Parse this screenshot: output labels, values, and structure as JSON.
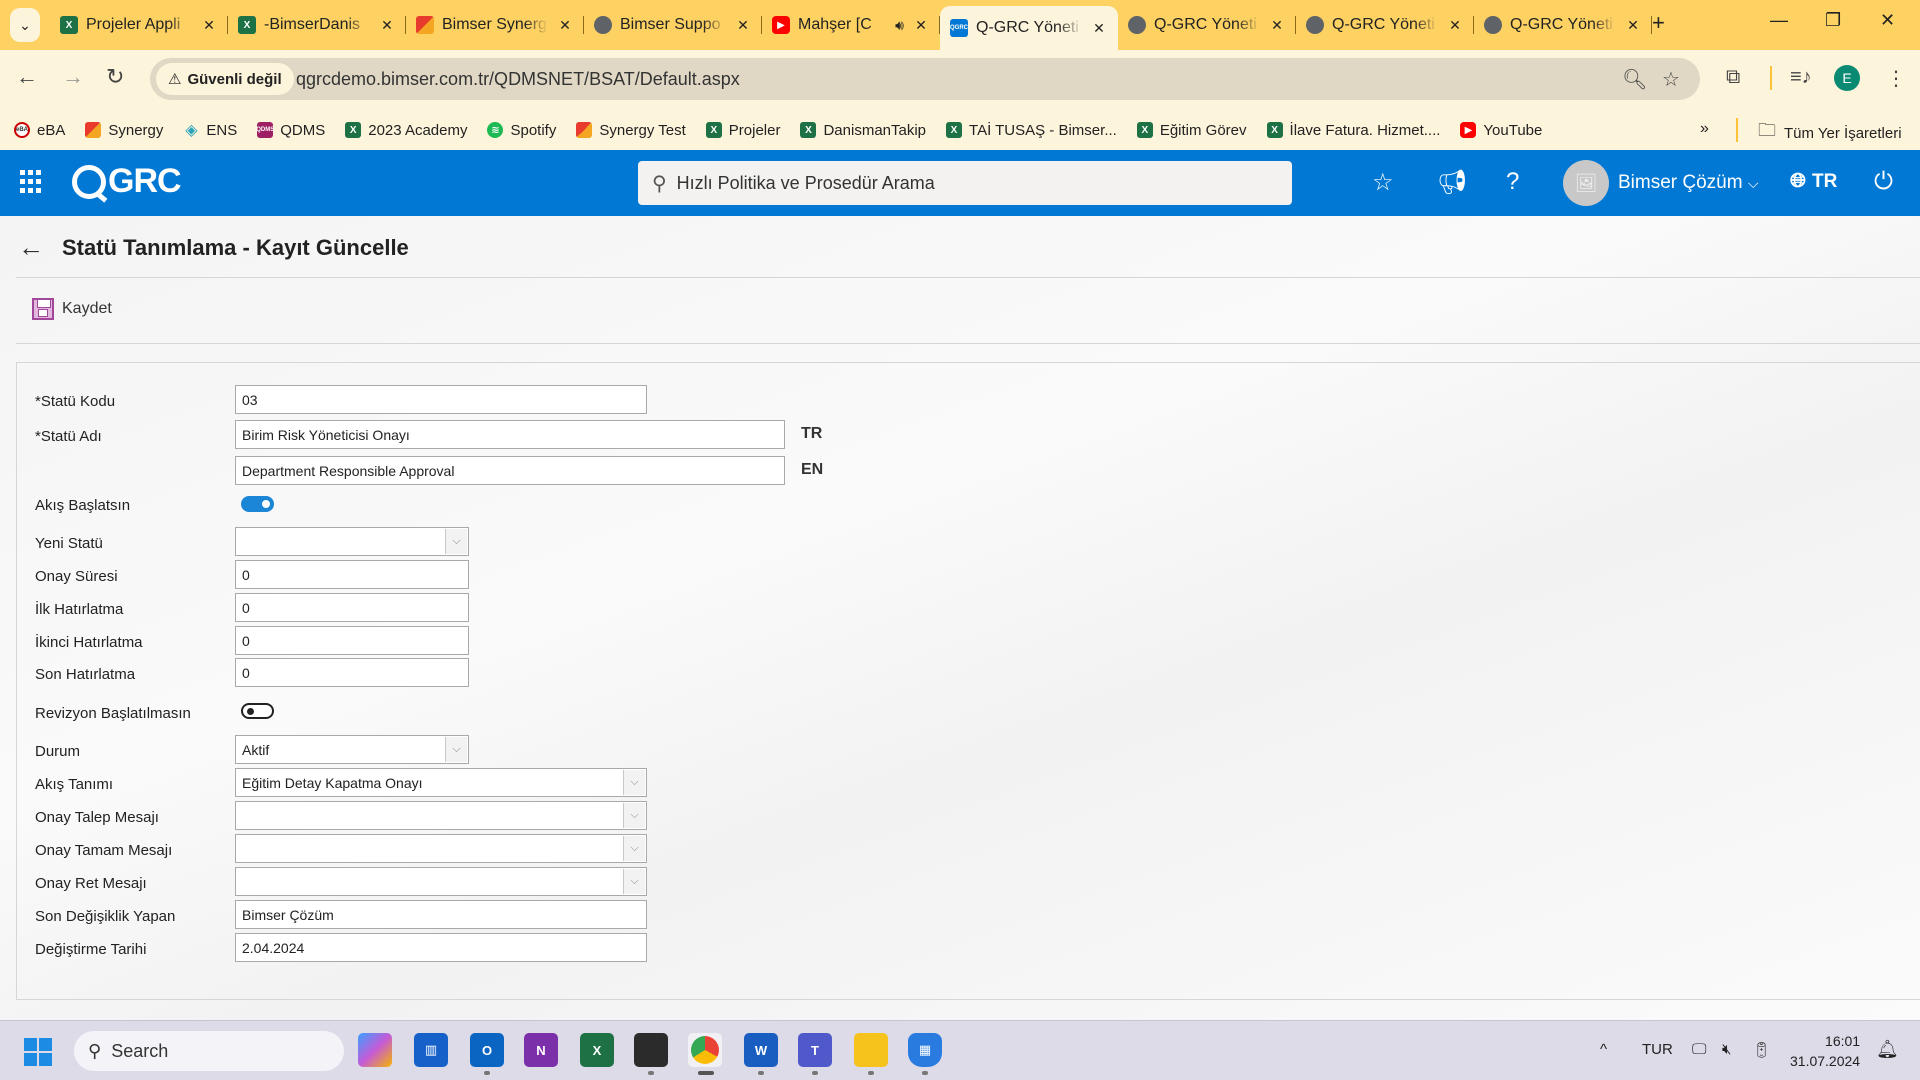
{
  "browser": {
    "tabs": [
      {
        "title": "Projeler Appli",
        "icon": "excel-icon",
        "active": false
      },
      {
        "title": "-BimserDanis",
        "icon": "excel-icon",
        "active": false
      },
      {
        "title": "Bimser Synerg",
        "icon": "synergy-icon",
        "active": false
      },
      {
        "title": "Bimser Suppo",
        "icon": "globe-icon",
        "active": false
      },
      {
        "title": "Mahşer [C",
        "icon": "youtube-icon",
        "active": false,
        "audio": true
      },
      {
        "title": "Q-GRC Yöneti",
        "icon": "qgrc-icon",
        "active": true
      },
      {
        "title": "Q-GRC Yöneti",
        "icon": "globe-icon",
        "active": false
      },
      {
        "title": "Q-GRC Yöneti",
        "icon": "globe-icon",
        "active": false
      },
      {
        "title": "Q-GRC Yöneti",
        "icon": "globe-icon",
        "active": false
      }
    ],
    "security_label": "Güvenli değil",
    "url": "qgrcdemo.bimser.com.tr/QDMSNET/BSAT/Default.aspx",
    "profile_initial": "E",
    "bookmarks": [
      {
        "label": "eBA",
        "icon": "eba-icon"
      },
      {
        "label": "Synergy",
        "icon": "synergy-icon"
      },
      {
        "label": "ENS",
        "icon": "ens-icon"
      },
      {
        "label": "QDMS",
        "icon": "qdms-icon"
      },
      {
        "label": "2023 Academy",
        "icon": "excel-icon"
      },
      {
        "label": "Spotify",
        "icon": "spotify-icon"
      },
      {
        "label": "Synergy Test",
        "icon": "synergy-icon"
      },
      {
        "label": "Projeler",
        "icon": "excel-icon"
      },
      {
        "label": "DanismanTakip",
        "icon": "excel-icon"
      },
      {
        "label": "TAİ TUSAŞ - Bimser...",
        "icon": "excel-icon"
      },
      {
        "label": "Eğitim Görev",
        "icon": "excel-icon"
      },
      {
        "label": "İlave Fatura. Hizmet....",
        "icon": "excel-icon"
      },
      {
        "label": "YouTube",
        "icon": "youtube-icon"
      }
    ],
    "all_bookmarks_label": "Tüm Yer İşaretleri"
  },
  "app": {
    "logo": "GRC",
    "search_placeholder": "Hızlı Politika ve Prosedür Arama",
    "user_name": "Bimser Çözüm",
    "language": "TR",
    "brand_color": "#0078d4"
  },
  "page": {
    "title": "Statü Tanımlama - Kayıt Güncelle",
    "save_label": "Kaydet"
  },
  "form": {
    "status_code": {
      "label": "*Statü Kodu",
      "value": "03"
    },
    "status_name": {
      "label": "*Statü Adı",
      "value_tr": "Birim Risk Yöneticisi Onayı",
      "value_en": "Department Responsible Approval",
      "tr_tag": "TR",
      "en_tag": "EN"
    },
    "start_flow": {
      "label": "Akış Başlatsın",
      "checked": true
    },
    "new_status": {
      "label": "Yeni Statü",
      "value": ""
    },
    "approval_time": {
      "label": "Onay Süresi",
      "value": "0"
    },
    "first_reminder": {
      "label": "İlk Hatırlatma",
      "value": "0"
    },
    "second_reminder": {
      "label": "İkinci Hatırlatma",
      "value": "0"
    },
    "last_reminder": {
      "label": "Son Hatırlatma",
      "value": "0"
    },
    "no_revision": {
      "label": "Revizyon Başlatılmasın",
      "checked": false
    },
    "state": {
      "label": "Durum",
      "value": "Aktif"
    },
    "flow_definition": {
      "label": "Akış Tanımı",
      "value": "Eğitim Detay Kapatma Onayı"
    },
    "request_message": {
      "label": "Onay Talep Mesajı",
      "value": ""
    },
    "complete_message": {
      "label": "Onay Tamam Mesajı",
      "value": ""
    },
    "reject_message": {
      "label": "Onay Ret Mesajı",
      "value": ""
    },
    "last_modified_by": {
      "label": "Son Değişiklik Yapan",
      "value": "Bimser Çözüm"
    },
    "modified_date": {
      "label": "Değiştirme Tarihi",
      "value": "2.04.2024"
    }
  },
  "taskbar": {
    "search_label": "Search",
    "language": "TUR",
    "time": "16:01",
    "date": "31.07.2024"
  }
}
